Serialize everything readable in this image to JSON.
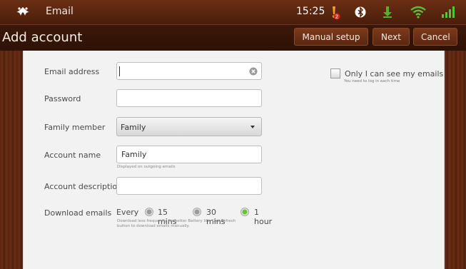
{
  "status_bar": {
    "app_name": "Email",
    "time": "15:25",
    "icons": [
      "email-app-icon",
      "notification-alert-icon",
      "bluetooth-icon",
      "download-icon",
      "wifi-icon",
      "signal-icon"
    ],
    "notification_count": "2"
  },
  "title_bar": {
    "title": "Add account",
    "buttons": {
      "manual": "Manual setup",
      "next": "Next",
      "cancel": "Cancel"
    }
  },
  "form": {
    "email": {
      "label": "Email address",
      "value": ""
    },
    "password": {
      "label": "Password",
      "value": ""
    },
    "family": {
      "label": "Family member",
      "selected": "Family"
    },
    "account_name": {
      "label": "Account name",
      "value": "Family",
      "hint": "Displayed on outgoing emails"
    },
    "account_description": {
      "label": "Account description",
      "value": ""
    },
    "download": {
      "label": "Download emails",
      "prefix": "Every",
      "options": [
        "15 mins",
        "30 mins",
        "1 hour"
      ],
      "selected": "1 hour",
      "hint_line1": "Download less frequently for better Battery life. Use Refresh",
      "hint_line2": "button to download emails manually."
    },
    "privacy": {
      "label": "Only I can see my emails",
      "hint": "You need to log in each time",
      "checked": false
    }
  },
  "colors": {
    "header_brown": "#4a1e0b",
    "accent_green": "#65c43a",
    "alert_orange": "#f0a020"
  }
}
